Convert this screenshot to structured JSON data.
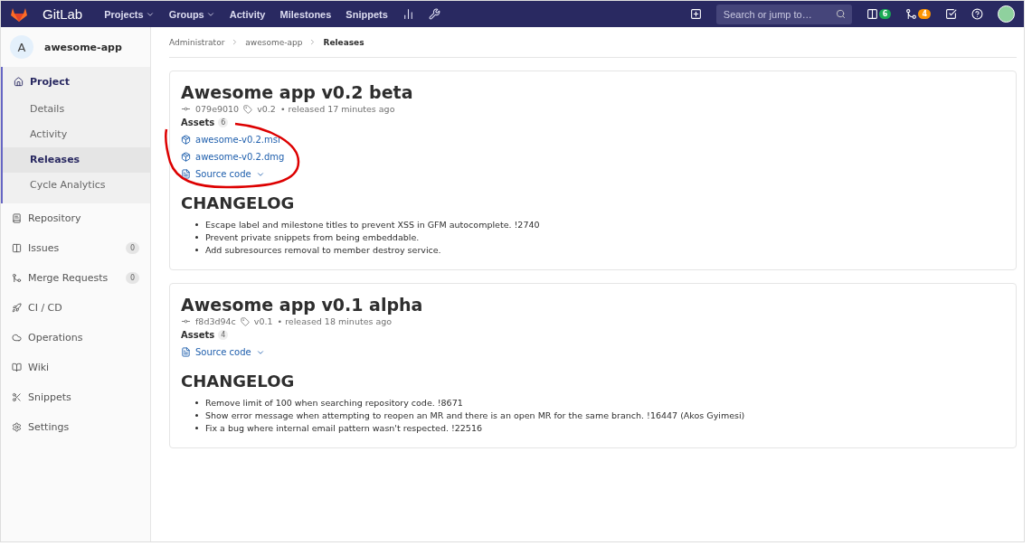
{
  "navbar": {
    "brand": "GitLab",
    "links": [
      {
        "label": "Projects",
        "dropdown": true
      },
      {
        "label": "Groups",
        "dropdown": true
      },
      {
        "label": "Activity",
        "dropdown": false
      },
      {
        "label": "Milestones",
        "dropdown": false
      },
      {
        "label": "Snippets",
        "dropdown": false
      }
    ],
    "search": {
      "placeholder": "Search or jump to…"
    },
    "counters": [
      {
        "kind": "issues",
        "count": "6",
        "color": "#1aaa55"
      },
      {
        "kind": "merge",
        "count": "4",
        "color": "#fc9403"
      }
    ]
  },
  "sidebar": {
    "project": {
      "avatar": "A",
      "name": "awesome-app"
    },
    "items": [
      {
        "kind": "project",
        "label": "Project",
        "expanded": true,
        "children": [
          {
            "label": "Details",
            "selected": false
          },
          {
            "label": "Activity",
            "selected": false
          },
          {
            "label": "Releases",
            "selected": true
          },
          {
            "label": "Cycle Analytics",
            "selected": false
          }
        ]
      },
      {
        "kind": "repository",
        "label": "Repository"
      },
      {
        "kind": "issues",
        "label": "Issues",
        "count": "0"
      },
      {
        "kind": "merge",
        "label": "Merge Requests",
        "count": "0"
      },
      {
        "kind": "cicd",
        "label": "CI / CD"
      },
      {
        "kind": "operations",
        "label": "Operations"
      },
      {
        "kind": "wiki",
        "label": "Wiki"
      },
      {
        "kind": "snippets",
        "label": "Snippets"
      },
      {
        "kind": "settings",
        "label": "Settings"
      }
    ]
  },
  "breadcrumbs": [
    "Administrator",
    "awesome-app",
    "Releases"
  ],
  "releases": [
    {
      "title": "Awesome app v0.2 beta",
      "commit": "079e9010",
      "tag": "v0.2",
      "released": "• released 17 minutes ago",
      "assets_label": "Assets",
      "assets_count": "6",
      "assets": [
        {
          "kind": "package",
          "label": "awesome-v0.2.msi"
        },
        {
          "kind": "package",
          "label": "awesome-v0.2.dmg"
        },
        {
          "kind": "source",
          "label": "Source code"
        }
      ],
      "changelog_title": "CHANGELOG",
      "changelog": [
        "Escape label and milestone titles to prevent XSS in GFM autocomplete. !2740",
        "Prevent private snippets from being embeddable.",
        "Add subresources removal to member destroy service."
      ],
      "annotated": true
    },
    {
      "title": "Awesome app v0.1 alpha",
      "commit": "f8d3d94c",
      "tag": "v0.1",
      "released": "• released 18 minutes ago",
      "assets_label": "Assets",
      "assets_count": "4",
      "assets": [
        {
          "kind": "source",
          "label": "Source code"
        }
      ],
      "changelog_title": "CHANGELOG",
      "changelog": [
        "Remove limit of 100 when searching repository code. !8671",
        "Show error message when attempting to reopen an MR and there is an open MR for the same branch. !16447 (Akos Gyimesi)",
        "Fix a bug where internal email pattern wasn't respected. !22516"
      ],
      "annotated": false
    }
  ]
}
